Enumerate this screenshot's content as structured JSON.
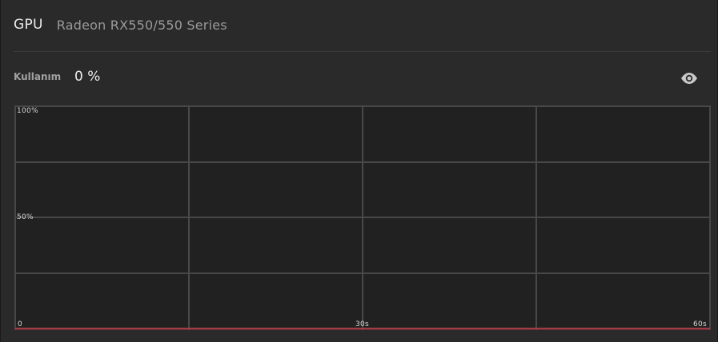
{
  "header": {
    "title": "GPU",
    "subtitle": "Radeon RX550/550 Series"
  },
  "usage": {
    "label": "Kullanım",
    "value": "0 %"
  },
  "eye_icon": "eye-icon",
  "colors": {
    "background": "#2a2a2a",
    "chart_background": "#212121",
    "grid": "#484848",
    "line": "#b33a45"
  },
  "chart": {
    "y_labels": [
      "100%",
      "50%"
    ],
    "x_labels": [
      "0",
      "30s",
      "60s"
    ]
  },
  "chart_data": {
    "type": "line",
    "x": [
      0,
      60
    ],
    "y": [
      0,
      0
    ],
    "xlim": [
      0,
      60
    ],
    "ylim": [
      0,
      100
    ],
    "ytick_labels": [
      "100%",
      "50%"
    ],
    "xtick_labels": [
      "0",
      "30s",
      "60s"
    ],
    "grid": true
  }
}
